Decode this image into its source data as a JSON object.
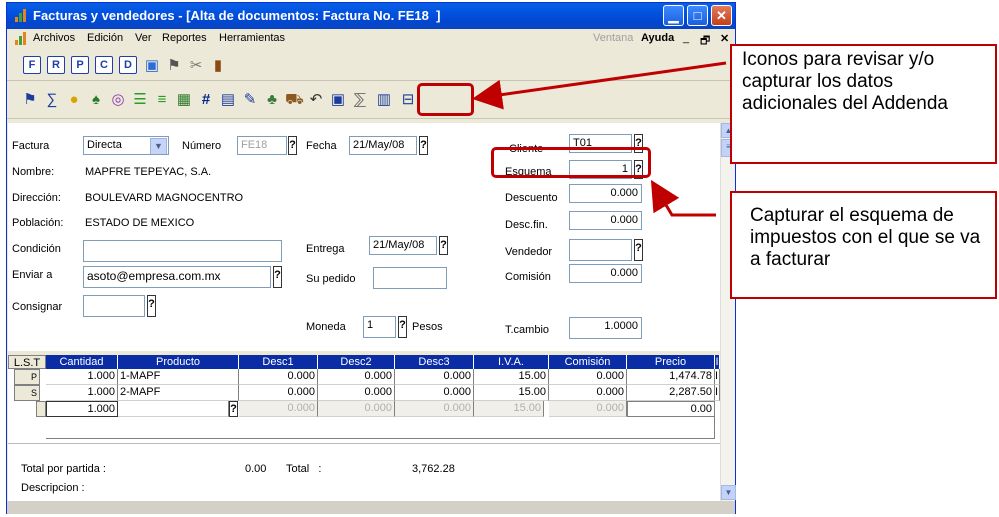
{
  "window": {
    "title": "Facturas y vendedores - [Alta de documentos: Factura No. FE18  ]"
  },
  "menu": {
    "items": [
      "Archivos",
      "Edición",
      "Ver",
      "Reportes",
      "Herramientas"
    ],
    "ventana": "Ventana",
    "ayuda": "Ayuda",
    "controls": [
      "_",
      "🗗",
      "✕"
    ]
  },
  "toolbar1": {
    "letters": [
      "F",
      "R",
      "P",
      "C",
      "D"
    ]
  },
  "form": {
    "factura_label": "Factura",
    "factura_value": "Directa",
    "numero_label": "Número",
    "numero_value": "FE18",
    "fecha_label": "Fecha",
    "fecha_value": "21/May/08",
    "cliente_label": "Cliente",
    "cliente_value": "T01",
    "nombre_label": "Nombre:",
    "nombre_value": "MAPFRE TEPEYAC, S.A.",
    "esquema_label": "Esquema",
    "esquema_value": "1",
    "direccion_label": "Dirección:",
    "direccion_value": "BOULEVARD MAGNOCENTRO",
    "descuento_label": "Descuento",
    "descuento_value": "0.000",
    "poblacion_label": "Población:",
    "poblacion_value": "ESTADO DE MEXICO",
    "descfin_label": "Desc.fin.",
    "descfin_value": "0.000",
    "condicion_label": "Condición",
    "condicion_value": "",
    "entrega_label": "Entrega",
    "entrega_value": "21/May/08",
    "vendedor_label": "Vendedor",
    "vendedor_value": "",
    "enviar_label": "Enviar a",
    "enviar_value": "asoto@empresa.com.mx",
    "supedido_label": "Su pedido",
    "supedido_value": "",
    "comision_label": "Comisión",
    "comision_value": "0.000",
    "consignar_label": "Consignar",
    "consignar_value": "",
    "moneda_label": "Moneda",
    "moneda_value": "1",
    "moneda_name": "Pesos",
    "tcambio_label": "T.cambio",
    "tcambio_value": "1.0000",
    "q": "?"
  },
  "grid": {
    "lst": "L.S.T",
    "headers": [
      "Cantidad",
      "Producto",
      "Desc1",
      "Desc2",
      "Desc3",
      "I.V.A.",
      "Comisión",
      "Precio",
      "I"
    ],
    "rows": [
      {
        "flag": "P",
        "cantidad": "1.000",
        "producto": "1-MAPF",
        "desc1": "0.000",
        "desc2": "0.000",
        "desc3": "0.000",
        "iva": "15.00",
        "comision": "0.000",
        "precio": "1,474.78",
        "last": "I"
      },
      {
        "flag": "S",
        "cantidad": "1.000",
        "producto": "2-MAPF",
        "desc1": "0.000",
        "desc2": "0.000",
        "desc3": "0.000",
        "iva": "15.00",
        "comision": "0.000",
        "precio": "2,287.50",
        "last": "I"
      },
      {
        "flag": "",
        "cantidad": "1.000",
        "producto": "",
        "desc1": "0.000",
        "desc2": "0.000",
        "desc3": "0.000",
        "iva": "15.00",
        "comision": "0.000",
        "precio": "0.00",
        "last": ""
      }
    ]
  },
  "footer": {
    "total_partida_label": "Total por partida :",
    "total_partida_value": "0.00",
    "total_label": "Total   :",
    "total_value": "3,762.28",
    "descripcion_label": "Descripcion :"
  },
  "callouts": {
    "addenda": "Iconos para revisar y/o capturar los datos adicionales del Addenda",
    "esquema": "Capturar el esquema de impuestos con el que se va a facturar"
  },
  "colors": {
    "accent": "#C00000",
    "header": "#0A2DA6",
    "titlebar": "#0355E3"
  }
}
